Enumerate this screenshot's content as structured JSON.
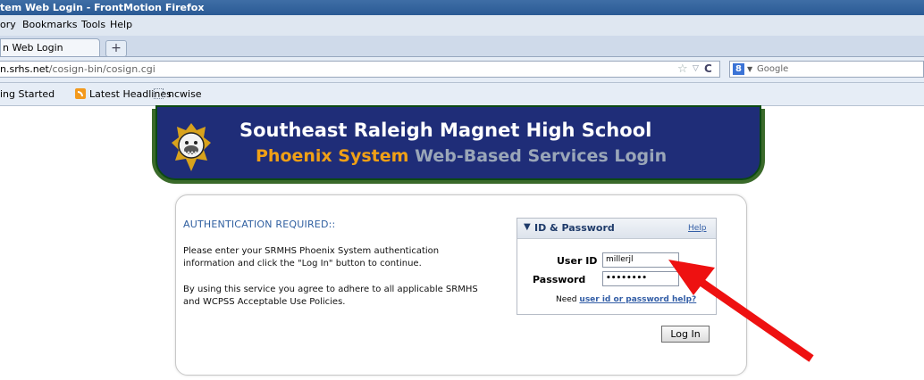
{
  "browser": {
    "window_title": "tem Web Login - FrontMotion Firefox",
    "menu": [
      "ory",
      "Bookmarks",
      "Tools",
      "Help"
    ],
    "tab_label": "n Web Login",
    "new_tab_symbol": "+",
    "url_domain": "n.srhs.net",
    "url_path": "/cosign-bin/cosign.cgi",
    "search_engine": "Google",
    "bookmarks": [
      "ing Started",
      "Latest Headlines",
      "ncwise"
    ]
  },
  "banner": {
    "title": "Southeast Raleigh Magnet High School",
    "subtitle_highlight": "Phoenix System",
    "subtitle_rest": "Web-Based Services Login"
  },
  "auth": {
    "heading": "AUTHENTICATION REQUIRED::",
    "paragraph1": "Please enter your SRMHS Phoenix System authentication information and click the \"Log In\" button to continue.",
    "paragraph2": "By using this service you agree to adhere to all applicable SRMHS and WCPSS Acceptable Use Policies."
  },
  "login_box": {
    "title": "ID & Password",
    "help": "Help",
    "user_label": "User ID",
    "user_value": "millerjl",
    "password_label": "Password",
    "password_value": "••••••••",
    "need_text": "Need",
    "need_link": "user id or password help?",
    "button": "Log In"
  },
  "colors": {
    "banner_bg": "#1f2d78",
    "accent_orange": "#f0a016",
    "annotation_arrow": "#ee1111"
  }
}
